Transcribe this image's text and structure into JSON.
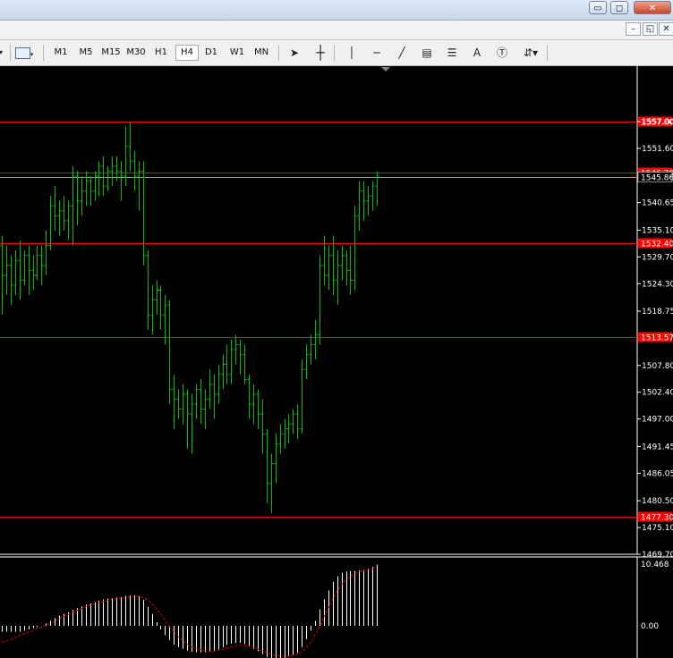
{
  "toolbar": {
    "timeframes": [
      "M1",
      "M5",
      "M15",
      "M30",
      "H1",
      "H4",
      "D1",
      "W1",
      "MN"
    ],
    "active_timeframe": "H4",
    "text_tool_label": "A"
  },
  "window_controls": {
    "minimize": "▭",
    "restore": "◻",
    "close": "✕"
  },
  "mdi_controls": {
    "minimize": "–",
    "restore": "◱",
    "close": "✕"
  },
  "price_axis": {
    "labels": [
      "1557.00",
      "1551.60",
      "1540.65",
      "1535.10",
      "1529.70",
      "1524.30",
      "1518.75",
      "1507.80",
      "1502.40",
      "1497.00",
      "1491.45",
      "1486.05",
      "1480.50",
      "1475.10",
      "1469.70"
    ],
    "current_price": "1545.86"
  },
  "levels": [
    "1557.00",
    "1546.70",
    "1532.40",
    "1513.57",
    "1477.30"
  ],
  "indicator_axis": {
    "labels": [
      "10.468",
      "0.00"
    ]
  },
  "colors": {
    "background": "#000000",
    "bars": "#00c000",
    "level_line": "#ff0000",
    "histogram": "#ffffff",
    "signal": "#e00000"
  },
  "chart_data": {
    "type": "ohlc-bar",
    "timeframe": "H4",
    "ylim": [
      1469.7,
      1560.0
    ],
    "bars": [
      [
        1532,
        1534,
        1518,
        1526
      ],
      [
        1526,
        1532,
        1522,
        1528
      ],
      [
        1528,
        1530,
        1520,
        1524
      ],
      [
        1524,
        1531,
        1522,
        1529
      ],
      [
        1529,
        1533,
        1521,
        1525
      ],
      [
        1525,
        1531,
        1524,
        1530
      ],
      [
        1530,
        1532,
        1522,
        1527
      ],
      [
        1527,
        1530,
        1523,
        1526
      ],
      [
        1526,
        1532,
        1525,
        1530
      ],
      [
        1530,
        1532,
        1524,
        1528
      ],
      [
        1528,
        1535,
        1526,
        1532
      ],
      [
        1532,
        1542,
        1531,
        1540
      ],
      [
        1540,
        1544,
        1535,
        1538
      ],
      [
        1538,
        1541,
        1534,
        1539
      ],
      [
        1539,
        1542,
        1535,
        1537
      ],
      [
        1537,
        1541,
        1533,
        1540
      ],
      [
        1540,
        1548,
        1532,
        1546
      ],
      [
        1546,
        1547,
        1536,
        1541
      ],
      [
        1541,
        1546,
        1538,
        1543
      ],
      [
        1543,
        1547,
        1540,
        1545
      ],
      [
        1545,
        1546,
        1540,
        1543
      ],
      [
        1543,
        1547,
        1541,
        1546
      ],
      [
        1546,
        1549,
        1542,
        1548
      ],
      [
        1548,
        1550,
        1542,
        1544
      ],
      [
        1544,
        1548,
        1543,
        1547
      ],
      [
        1547,
        1550,
        1544,
        1548
      ],
      [
        1548,
        1550,
        1545,
        1547
      ],
      [
        1547,
        1549,
        1541,
        1546
      ],
      [
        1546,
        1556,
        1544,
        1552
      ],
      [
        1552,
        1557,
        1547,
        1549
      ],
      [
        1549,
        1551,
        1543,
        1546
      ],
      [
        1546,
        1549,
        1539,
        1547
      ],
      [
        1547,
        1549,
        1528,
        1530
      ],
      [
        1530,
        1531,
        1515,
        1518
      ],
      [
        1518,
        1524,
        1514,
        1521
      ],
      [
        1521,
        1525,
        1518,
        1523
      ],
      [
        1523,
        1524,
        1515,
        1518
      ],
      [
        1518,
        1522,
        1512,
        1520
      ],
      [
        1520,
        1521,
        1500,
        1503
      ],
      [
        1503,
        1506,
        1495,
        1501
      ],
      [
        1501,
        1503,
        1497,
        1499
      ],
      [
        1499,
        1504,
        1496,
        1502
      ],
      [
        1502,
        1503,
        1491,
        1498
      ],
      [
        1498,
        1502,
        1490,
        1500
      ],
      [
        1500,
        1504,
        1497,
        1503
      ],
      [
        1503,
        1505,
        1496,
        1499
      ],
      [
        1499,
        1503,
        1495,
        1501
      ],
      [
        1501,
        1507,
        1499,
        1504
      ],
      [
        1504,
        1506,
        1497,
        1502
      ],
      [
        1502,
        1508,
        1500,
        1506
      ],
      [
        1506,
        1510,
        1503,
        1508
      ],
      [
        1508,
        1512,
        1504,
        1506
      ],
      [
        1506,
        1513,
        1504,
        1511
      ],
      [
        1511,
        1514,
        1508,
        1512
      ],
      [
        1512,
        1513,
        1506,
        1510
      ],
      [
        1510,
        1512,
        1504,
        1505
      ],
      [
        1505,
        1506,
        1497,
        1500
      ],
      [
        1500,
        1504,
        1496,
        1502
      ],
      [
        1502,
        1503,
        1495,
        1498
      ],
      [
        1498,
        1501,
        1490,
        1494
      ],
      [
        1494,
        1495,
        1480,
        1484
      ],
      [
        1484,
        1490,
        1478,
        1488
      ],
      [
        1488,
        1494,
        1484,
        1492
      ],
      [
        1492,
        1496,
        1490,
        1494
      ],
      [
        1494,
        1497,
        1491,
        1495
      ],
      [
        1495,
        1498,
        1492,
        1496
      ],
      [
        1496,
        1499,
        1494,
        1498
      ],
      [
        1498,
        1500,
        1493,
        1495
      ],
      [
        1495,
        1509,
        1494,
        1507
      ],
      [
        1507,
        1512,
        1505,
        1510
      ],
      [
        1510,
        1514,
        1508,
        1512
      ],
      [
        1512,
        1517,
        1509,
        1514
      ],
      [
        1514,
        1530,
        1512,
        1528
      ],
      [
        1528,
        1534,
        1524,
        1526
      ],
      [
        1526,
        1532,
        1523,
        1530
      ],
      [
        1530,
        1534,
        1522,
        1525
      ],
      [
        1525,
        1531,
        1520,
        1528
      ],
      [
        1528,
        1532,
        1525,
        1530
      ],
      [
        1530,
        1531,
        1524,
        1527
      ],
      [
        1527,
        1532,
        1522,
        1525
      ],
      [
        1525,
        1540,
        1523,
        1538
      ],
      [
        1538,
        1545,
        1535,
        1543
      ],
      [
        1543,
        1545,
        1537,
        1541
      ],
      [
        1541,
        1544,
        1538,
        1542
      ],
      [
        1542,
        1545,
        1539,
        1544
      ],
      [
        1544,
        1547,
        1540,
        1546
      ]
    ],
    "indicator": {
      "max": 10.468,
      "zero": 0.0,
      "histogram": [
        -1,
        -1,
        -1,
        -1,
        -1,
        -0.8,
        -0.6,
        -0.4,
        -0.2,
        0,
        0.4,
        0.9,
        1.3,
        1.7,
        2.0,
        2.3,
        2.7,
        3.0,
        3.3,
        3.6,
        3.8,
        4.0,
        4.3,
        4.5,
        4.6,
        4.7,
        4.8,
        4.9,
        5.1,
        5.2,
        5.2,
        5.0,
        4.4,
        3.2,
        2.0,
        0.6,
        -0.6,
        -1.6,
        -2.4,
        -3.2,
        -3.6,
        -3.9,
        -4.2,
        -4.4,
        -4.5,
        -4.5,
        -4.5,
        -4.4,
        -4.2,
        -4.0,
        -3.6,
        -3.2,
        -3.0,
        -2.9,
        -2.9,
        -3.1,
        -3.5,
        -3.9,
        -4.3,
        -4.8,
        -5.3,
        -5.5,
        -5.6,
        -5.6,
        -5.4,
        -5.2,
        -4.9,
        -4.6,
        -3.6,
        -2.3,
        -0.8,
        0.8,
        2.8,
        4.5,
        6.0,
        7.5,
        8.4,
        9.0,
        9.2,
        9.3,
        9.3,
        9.4,
        9.5,
        9.7,
        10.0,
        10.4
      ],
      "signal": [
        -2.8,
        -2.6,
        -2.3,
        -2.0,
        -1.7,
        -1.4,
        -1.1,
        -0.8,
        -0.5,
        -0.2,
        0.1,
        0.4,
        0.8,
        1.2,
        1.6,
        1.9,
        2.3,
        2.6,
        2.9,
        3.2,
        3.5,
        3.7,
        3.9,
        4.1,
        4.3,
        4.5,
        4.6,
        4.7,
        4.8,
        4.9,
        5.0,
        5.0,
        4.8,
        4.4,
        3.8,
        3.0,
        2.0,
        1.0,
        0.0,
        -1.0,
        -1.8,
        -2.5,
        -3.1,
        -3.5,
        -3.8,
        -4.0,
        -4.2,
        -4.3,
        -4.3,
        -4.2,
        -4.0,
        -3.8,
        -3.6,
        -3.4,
        -3.3,
        -3.3,
        -3.4,
        -3.6,
        -3.9,
        -4.2,
        -4.5,
        -4.8,
        -5.0,
        -5.1,
        -5.2,
        -5.1,
        -5.0,
        -4.8,
        -4.4,
        -3.7,
        -2.8,
        -1.6,
        -0.2,
        1.4,
        3.0,
        4.6,
        5.9,
        7.0,
        7.8,
        8.4,
        8.8,
        9.1,
        9.3,
        9.5,
        9.7,
        9.9
      ]
    }
  }
}
